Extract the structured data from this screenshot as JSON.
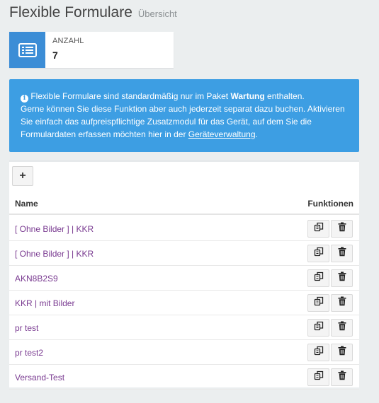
{
  "header": {
    "title": "Flexible Formulare",
    "subtitle": "Übersicht"
  },
  "stat": {
    "icon": "list-card-icon",
    "label": "ANZAHL",
    "value": "7"
  },
  "info": {
    "icon": "info-circle-icon",
    "text_1": "Flexible Formulare sind standardmäßig nur im Paket ",
    "text_bold": "Wartung",
    "text_2": " enthalten.",
    "line_2": "Gerne können Sie diese Funktion aber auch jederzeit separat dazu buchen. Aktivieren Sie einfach das aufpreispflichtige Zusatzmodul für das Gerät, auf dem Sie die Formulardaten erfassen möchten hier in der ",
    "link": "Geräteverwaltung",
    "end": "."
  },
  "table": {
    "add_label": "+",
    "col_name": "Name",
    "col_functions": "Funktionen",
    "rows": [
      "[ Ohne Bilder ] | KKR",
      "[ Ohne Bilder ] | KKR",
      "AKN8B2S9",
      "KKR | mit Bilder",
      "pr test",
      "pr test2",
      "Versand-Test"
    ],
    "action_icons": [
      "copy-icon",
      "trash-icon"
    ]
  },
  "colors": {
    "accent": "#3c8dd6",
    "info_bg": "#3d9ee3",
    "link": "#7a3b91",
    "background": "#ebeeef"
  }
}
